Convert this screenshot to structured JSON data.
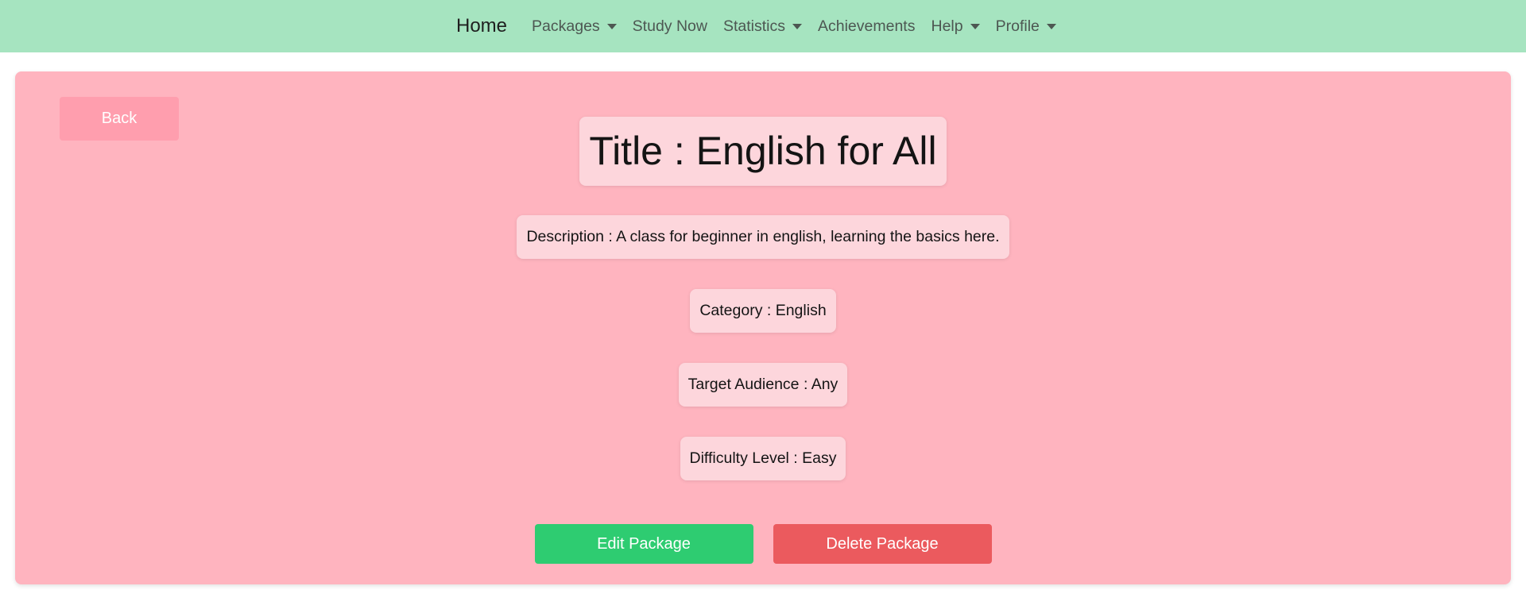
{
  "navbar": {
    "brand": "Home",
    "items": [
      {
        "label": "Packages",
        "dropdown": true
      },
      {
        "label": "Study Now",
        "dropdown": false
      },
      {
        "label": "Statistics",
        "dropdown": true
      },
      {
        "label": "Achievements",
        "dropdown": false
      },
      {
        "label": "Help",
        "dropdown": true
      },
      {
        "label": "Profile",
        "dropdown": true
      }
    ]
  },
  "package": {
    "back_label": "Back",
    "title": "Title : English for All",
    "description": "Description : A class for beginner in english, learning the basics here.",
    "category": "Category : English",
    "target_audience": "Target Audience : Any",
    "difficulty": "Difficulty Level : Easy",
    "edit_label": "Edit Package",
    "delete_label": "Delete Package"
  },
  "colors": {
    "navbar_bg": "#a6e4c0",
    "card_bg": "#ffb4bf",
    "pill_bg": "#fdd6dc",
    "back_btn": "#ff9eae",
    "edit_btn": "#2ecc71",
    "delete_btn": "#eb5a5e"
  }
}
